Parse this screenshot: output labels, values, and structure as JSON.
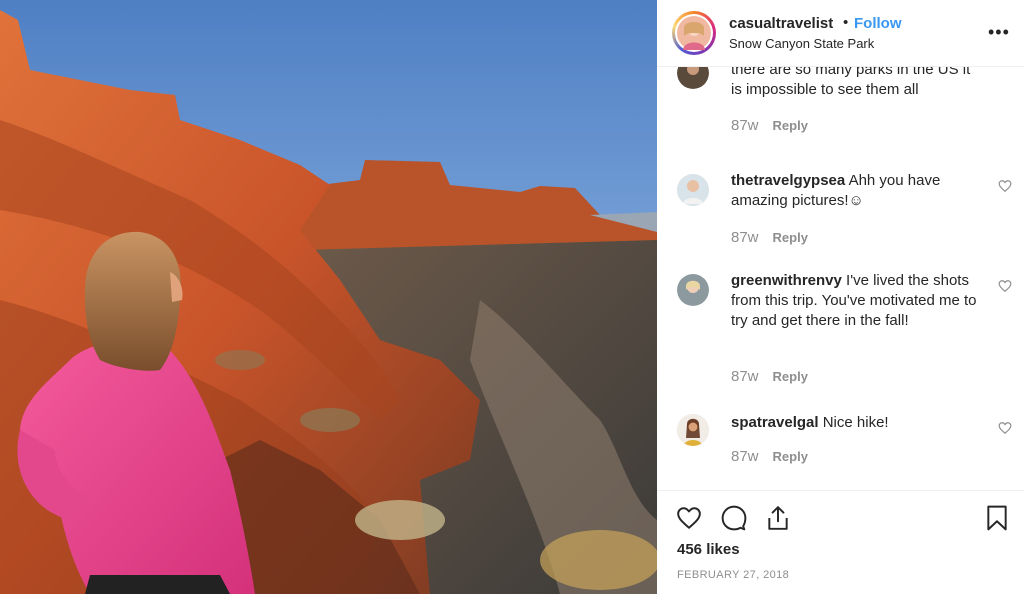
{
  "post": {
    "username": "casualtravelist",
    "separator": "•",
    "follow_label": "Follow",
    "location": "Snow Canyon State Park",
    "more_icon": "ellipsis-icon",
    "more_label": "•••"
  },
  "comments": [
    {
      "username": "",
      "text": "there are so many parks in the US it is impossible to see them all",
      "age": "87w",
      "reply_label": "Reply"
    },
    {
      "username": "thetravelgypsea",
      "text": "Ahh you have amazing pictures!☺",
      "age": "87w",
      "reply_label": "Reply"
    },
    {
      "username": "greenwithrenvy",
      "text": "I've lived the shots from this trip. You've motivated me to try and get there in the fall!",
      "age": "87w",
      "reply_label": "Reply"
    },
    {
      "username": "spatravelgal",
      "text": "Nice hike!",
      "age": "87w",
      "reply_label": "Reply"
    }
  ],
  "footer": {
    "likes": "456 likes",
    "date": "FEBRUARY 27, 2018"
  },
  "colors": {
    "follow": "#3897f0",
    "text": "#262626",
    "muted": "#8e8e8e"
  }
}
